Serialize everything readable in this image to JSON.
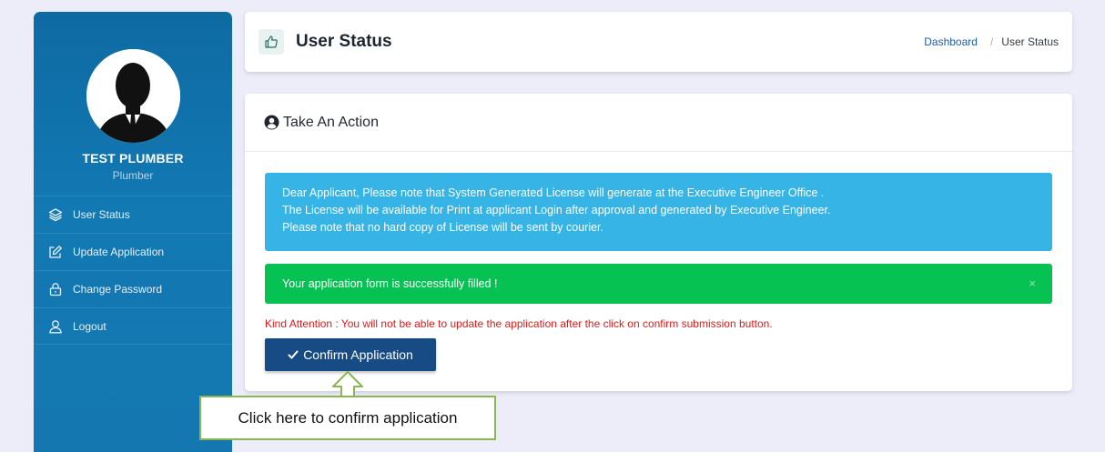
{
  "sidebar": {
    "user_name": "TEST PLUMBER",
    "user_role": "Plumber",
    "items": [
      {
        "label": "User Status",
        "icon": "layers-icon"
      },
      {
        "label": "Update Application",
        "icon": "edit-icon"
      },
      {
        "label": "Change Password",
        "icon": "lock-icon"
      },
      {
        "label": "Logout",
        "icon": "user-icon"
      }
    ]
  },
  "header": {
    "title": "User Status",
    "icon": "thumbs-up-icon",
    "breadcrumb": [
      "Dashboard",
      "User Status"
    ]
  },
  "card": {
    "title": "Take An Action",
    "title_icon": "user-circle-icon",
    "info_lines": [
      "Dear Applicant, Please note that System Generated License will generate at the Executive Engineer Office .",
      "The License will be available for Print at applicant Login after approval and generated by Executive Engineer.",
      "Please note that no hard copy of License will be sent by courier."
    ],
    "success_message": "Your application form is successfully filled !",
    "success_close": "×",
    "attention": "Kind Attention : You will not be able to update the application after the click on confirm submission button.",
    "confirm_button": "Confirm Application"
  },
  "callout": {
    "text": "Click here to confirm application"
  },
  "colors": {
    "sidebar": "#1279b3",
    "info_alert": "#36b4e5",
    "success_alert": "#05c253",
    "attention_text": "#e01a1a",
    "primary_button": "#174b84",
    "callout_border": "#8ab752"
  }
}
